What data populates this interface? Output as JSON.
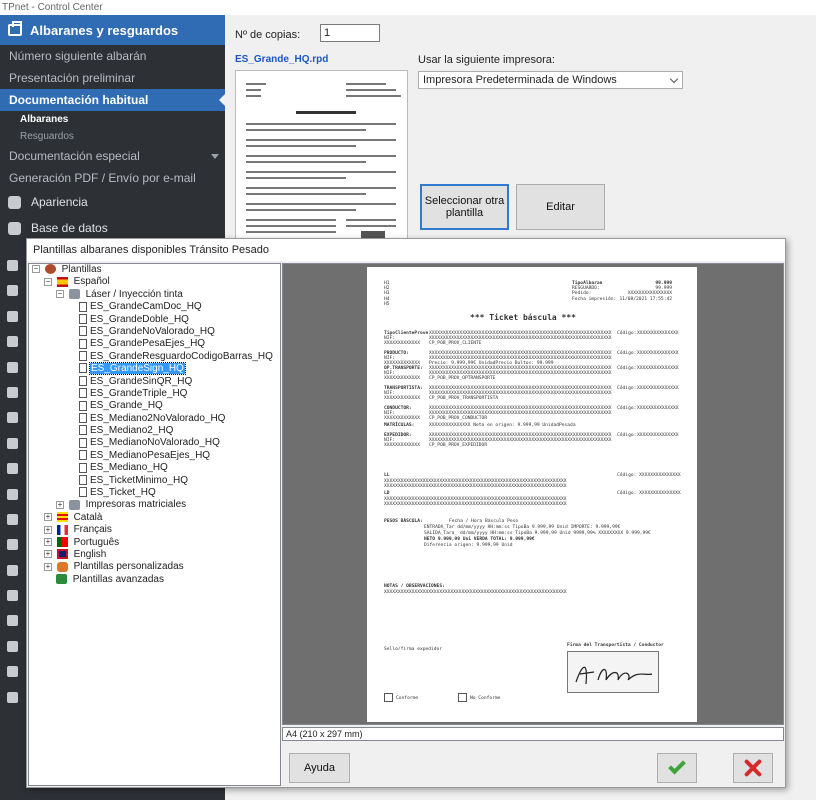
{
  "window": {
    "title": "TPnet - Control Center"
  },
  "nav": {
    "header": "Albaranes y resguardos",
    "items": [
      {
        "label": "Número siguiente albarán"
      },
      {
        "label": "Presentación preliminar"
      },
      {
        "label": "Documentación habitual"
      },
      {
        "label": "Documentación especial"
      },
      {
        "label": "Generación PDF / Envío por e-mail"
      }
    ],
    "subitems": [
      {
        "label": "Albaranes"
      },
      {
        "label": "Resguardos"
      }
    ],
    "sections": [
      {
        "label": "Apariencia"
      },
      {
        "label": "Base de datos"
      }
    ]
  },
  "main": {
    "copies_label": "Nº de copias:",
    "copies_value": "1",
    "file_name": "ES_Grande_HQ.rpd",
    "printer_label": "Usar la siguiente impresora:",
    "printer_value": "Impresora Predeterminada de Windows",
    "btn_select": "Seleccionar otra plantilla",
    "btn_edit": "Editar"
  },
  "dialog": {
    "title": "Plantillas albaranes disponibles Tránsito Pesado",
    "tree": {
      "root": "Plantillas",
      "lang_es": "Español",
      "laser": "Láser / Inyección tinta",
      "templates": [
        "ES_GrandeCamDoc_HQ",
        "ES_GrandeDoble_HQ",
        "ES_GrandeNoValorado_HQ",
        "ES_GrandePesaEjes_HQ",
        "ES_GrandeResguardoCodigoBarras_HQ",
        "ES_GrandeSign_HQ",
        "ES_GrandeSinQR_HQ",
        "ES_GrandeTriple_HQ",
        "ES_Grande_HQ",
        "ES_Mediano2NoValorado_HQ",
        "ES_Mediano2_HQ",
        "ES_MedianoNoValorado_HQ",
        "ES_MedianoPesaEjes_HQ",
        "ES_Mediano_HQ",
        "ES_TicketMinimo_HQ",
        "ES_Ticket_HQ"
      ],
      "matrix": "Impresoras matriciales",
      "lang_ca": "Català",
      "lang_fr": "Français",
      "lang_pt": "Português",
      "lang_en": "English",
      "custom": "Plantillas personalizadas",
      "advanced": "Plantillas avanzadas"
    },
    "preview": {
      "h_lines": [
        "H1",
        "H2",
        "H3",
        "H4",
        "H5"
      ],
      "tipo_albaran": "TipoAlbaran",
      "tipo_albaran_val": "99.999",
      "resguardo": "RESGUARDO:",
      "resguardo_val": "99.999",
      "pedido": "Pedido:",
      "pedido_val": "XXXXXXXXXXXXXXXX",
      "fecha": "Fecha impresión:",
      "fecha_val": "11/08/2021 17:55:42",
      "title": "*** Ticket báscula ***",
      "xs": "XXXXXXXXXXXXXXXXXXXXXXXXXXXXXXXXXXXXXXXXXXXXXXXXXXXXXXXXXXXXXXXXXX",
      "codigo": "Código:",
      "codigo_val": "XXXXXXXXXXXXXXX",
      "nif": "NIF:",
      "nif_val": "XXXXXXXXXXXXX",
      "sections": [
        {
          "label": "TipoClienteProve",
          "sub": "CP_POB_PROV_CLIENTE"
        },
        {
          "label": "PRODUCTO:",
          "sub": "Precio: 9.999,99€ UnidadPrecio     Bultos: 99.999"
        },
        {
          "label": "OP.TRANSPORTE:",
          "sub": "CP_POB_PROV_OPTRANSPORTE"
        },
        {
          "label": "TRANSPORTISTA:",
          "sub": "CP_POB_PROV_TRANSPORTISTA"
        },
        {
          "label": "CONDUCTOR:",
          "sub": "CP_POB_PROV_CONDUCTOR"
        },
        {
          "label": "MATRÍCULAS:",
          "sub": "XXXXXXXXXXXXXXX      Neto en origen:   9.999,99 UnidadPesada"
        },
        {
          "label": "EXPEDIDOR:",
          "sub": "CP_POB_PROV_EXPEDIDOR"
        }
      ],
      "ll": "LL",
      "ld": "LD",
      "pesos": "PESOS BÁSCULA:",
      "pesos_header": "Fecha / Hora        Báscula      Peso",
      "pesos_rows": [
        "ENTRADA_Tar  dd/mm/yyyy HH:mm:ss  TipoBa   9.999,99 Unid      IMPORTE:        9.999,99€",
        "SALIDA_Tara_  dd/mm/yyyy HH:mm:ss  TipoBa   9.999,99 Unid   9999,99%  XXXXXXXXX  9.999,99€",
        "NETO                                      9.999,99 Uni VERDA   TOTAL:        9.999,99€",
        "Diferencia origen:                        9.999,99 Unid"
      ],
      "notas": "NOTAS / OBSERVACIONES:",
      "sello": "Sello/firma expedidor",
      "firma": "Firma del Transportista / Conductor",
      "conforme": "Conforme",
      "noconforme": "No Conforme"
    },
    "paper_size": "A4 (210 x 297 mm)",
    "btn_help": "Ayuda"
  }
}
